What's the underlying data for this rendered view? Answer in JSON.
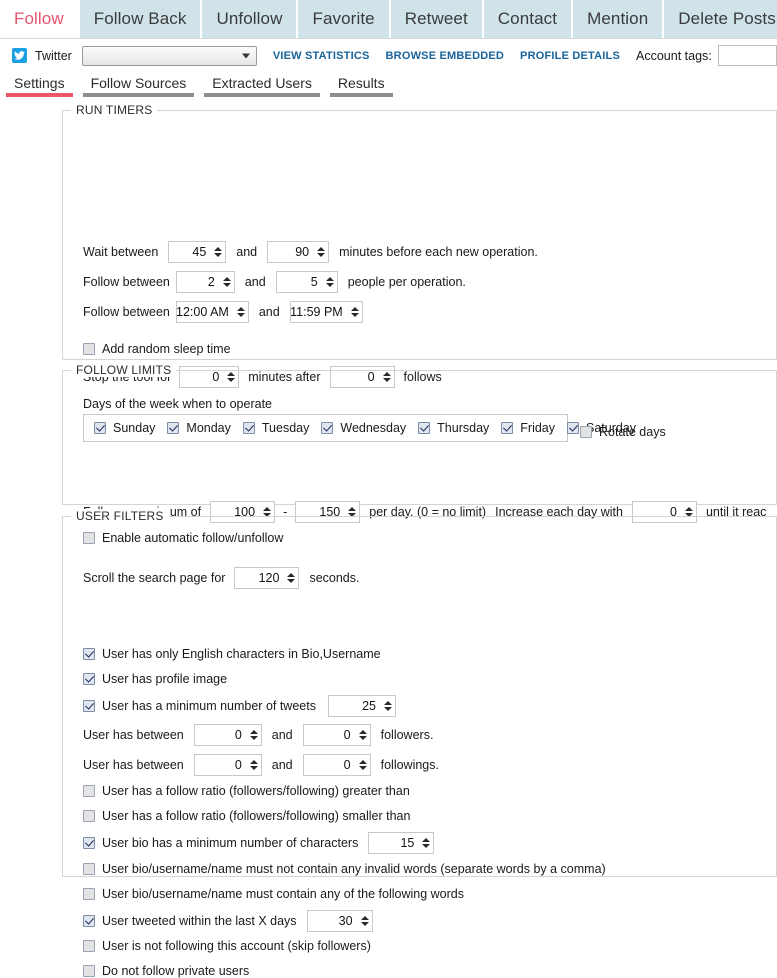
{
  "main_tabs": [
    {
      "label": "Follow",
      "active": true
    },
    {
      "label": "Follow Back",
      "active": false
    },
    {
      "label": "Unfollow",
      "active": false
    },
    {
      "label": "Favorite",
      "active": false
    },
    {
      "label": "Retweet",
      "active": false
    },
    {
      "label": "Contact",
      "active": false
    },
    {
      "label": "Mention",
      "active": false
    },
    {
      "label": "Delete Posts",
      "active": false
    }
  ],
  "account_bar": {
    "platform_icon": "twitter-bird-icon",
    "platform_label": "Twitter",
    "account_select_value": "",
    "links": [
      {
        "label": "VIEW STATISTICS",
        "name": "view-statistics-link"
      },
      {
        "label": "BROWSE EMBEDDED",
        "name": "browse-embedded-link"
      },
      {
        "label": "PROFILE DETAILS",
        "name": "profile-details-link"
      }
    ],
    "account_tags_label": "Account tags:",
    "account_tags_value": "",
    "account_tags_placeholder": ""
  },
  "sub_tabs": [
    {
      "label": "Settings",
      "active": true
    },
    {
      "label": "Follow Sources",
      "active": false
    },
    {
      "label": "Extracted Users",
      "active": false
    },
    {
      "label": "Results",
      "active": false
    }
  ],
  "run_timers": {
    "title": "RUN TIMERS",
    "wait": {
      "label": "Wait between",
      "min": "45",
      "and": "and",
      "max": "90",
      "suffix": "minutes before each new operation."
    },
    "people": {
      "label": "Follow between",
      "min": "2",
      "and": "and",
      "max": "5",
      "suffix": "people per operation."
    },
    "hours": {
      "label": "Follow between",
      "from": "12:00 AM",
      "and": "and",
      "to": "11:59 PM"
    },
    "random_sleep": {
      "label": "Add random sleep time",
      "checked": false
    },
    "stop_tool": {
      "label": "Stop the tool for",
      "minutes": "0",
      "mid": "minutes after",
      "follows": "0",
      "suffix": "follows"
    },
    "days_label": "Days of the week when to operate",
    "days": [
      {
        "label": "Sunday",
        "checked": true
      },
      {
        "label": "Monday",
        "checked": true
      },
      {
        "label": "Tuesday",
        "checked": true
      },
      {
        "label": "Wednesday",
        "checked": true
      },
      {
        "label": "Thursday",
        "checked": true
      },
      {
        "label": "Friday",
        "checked": true
      },
      {
        "label": "Saturday",
        "checked": true
      }
    ],
    "rotate_days": {
      "label": "Rotate days",
      "checked": false
    }
  },
  "follow_limits": {
    "title": "FOLLOW LIMITS",
    "maximum": {
      "label": "Follow a maximum of",
      "min": "100",
      "dash": "-",
      "max": "150",
      "mid": "per day. (0 = no limit)",
      "increase_label": "Increase each day with",
      "increase_value": "0",
      "tail": "until it reac"
    },
    "auto_follow_unfollow": {
      "label": "Enable automatic follow/unfollow",
      "checked": false
    },
    "scroll": {
      "label": "Scroll the search page for",
      "value": "120",
      "suffix": "seconds."
    }
  },
  "user_filters": {
    "title": "USER FILTERS",
    "english_chars": {
      "label": "User has only English characters in Bio,Username",
      "checked": true
    },
    "profile_image": {
      "label": "User has profile image",
      "checked": true
    },
    "min_tweets": {
      "label": "User has a minimum number of tweets",
      "checked": true,
      "value": "25"
    },
    "followers_range": {
      "label": "User has between",
      "min": "0",
      "and": "and",
      "max": "0",
      "suffix": "followers."
    },
    "followings_range": {
      "label": "User has between",
      "min": "0",
      "and": "and",
      "max": "0",
      "suffix": "followings."
    },
    "ratio_greater": {
      "label": "User has a follow ratio (followers/following) greater than",
      "checked": false
    },
    "ratio_smaller": {
      "label": "User has a follow ratio (followers/following) smaller than",
      "checked": false
    },
    "bio_min_chars": {
      "label": "User bio has a minimum number of characters",
      "checked": true,
      "value": "15"
    },
    "no_invalid_words": {
      "label": "User bio/username/name must not contain any invalid words (separate words by a comma)",
      "checked": false
    },
    "must_contain_words": {
      "label": "User bio/username/name must contain any of the following words",
      "checked": false
    },
    "tweeted_within": {
      "label": "User tweeted within the last X days",
      "checked": true,
      "value": "30"
    },
    "not_following": {
      "label": "User is not following this account (skip followers)",
      "checked": false
    },
    "no_private": {
      "label": "Do not follow private users",
      "checked": false
    }
  },
  "colors": {
    "tab_inactive": "#cfe3e9",
    "active_accent": "#e2556a",
    "link": "#18649b",
    "twitter_blue": "#1da0e2"
  }
}
